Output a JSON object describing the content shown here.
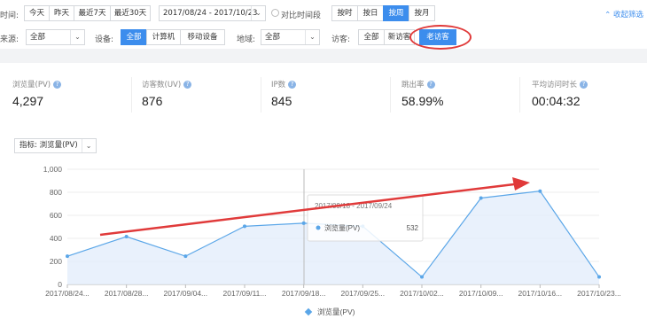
{
  "filters": {
    "time_label": "时间:",
    "time_buttons": [
      "今天",
      "昨天",
      "最近7天",
      "最近30天"
    ],
    "date_range": "2017/08/24 - 2017/10/23",
    "compare_label": "对比时间段",
    "granularity": [
      "按时",
      "按日",
      "按周",
      "按月"
    ],
    "active_granularity": "按周",
    "collapse_label": "收起筛选",
    "source_label": "来源:",
    "source_value": "全部",
    "device_label": "设备:",
    "device_buttons": [
      "全部",
      "计算机",
      "移动设备"
    ],
    "region_label": "地域:",
    "region_value": "全部",
    "visitor_label": "访客:",
    "visitor_buttons": [
      "全部",
      "新访客",
      "老访客"
    ],
    "active_visitor": "老访客"
  },
  "metrics": [
    {
      "name": "浏览量(PV)",
      "value": "4,297"
    },
    {
      "name": "访客数(UV)",
      "value": "876"
    },
    {
      "name": "IP数",
      "value": "845"
    },
    {
      "name": "跳出率",
      "value": "58.99%"
    },
    {
      "name": "平均访问时长",
      "value": "00:04:32"
    }
  ],
  "indicator": {
    "label": "指标:",
    "value": "浏览量(PV)"
  },
  "tooltip": {
    "title": "2017/09/18 - 2017/09/24",
    "series": "浏览量(PV)",
    "value": "532"
  },
  "colors": {
    "accent": "#3c8ded",
    "line": "#5aa6e8",
    "area": "#e3eefb",
    "arrow": "#e03a3a"
  },
  "chart_data": {
    "type": "area",
    "x": [
      "2017/08/24...",
      "2017/08/28...",
      "2017/09/04...",
      "2017/09/11...",
      "2017/09/18...",
      "2017/09/25...",
      "2017/10/02...",
      "2017/10/09...",
      "2017/10/16...",
      "2017/10/23..."
    ],
    "series": [
      {
        "name": "浏览量(PV)",
        "values": [
          245,
          415,
          245,
          505,
          532,
          505,
          65,
          750,
          810,
          65
        ]
      }
    ],
    "ylim": [
      0,
      1000
    ],
    "yticks": [
      "0",
      "200",
      "400",
      "600",
      "800",
      "1,000"
    ],
    "legend": "bottom",
    "grid": true
  }
}
